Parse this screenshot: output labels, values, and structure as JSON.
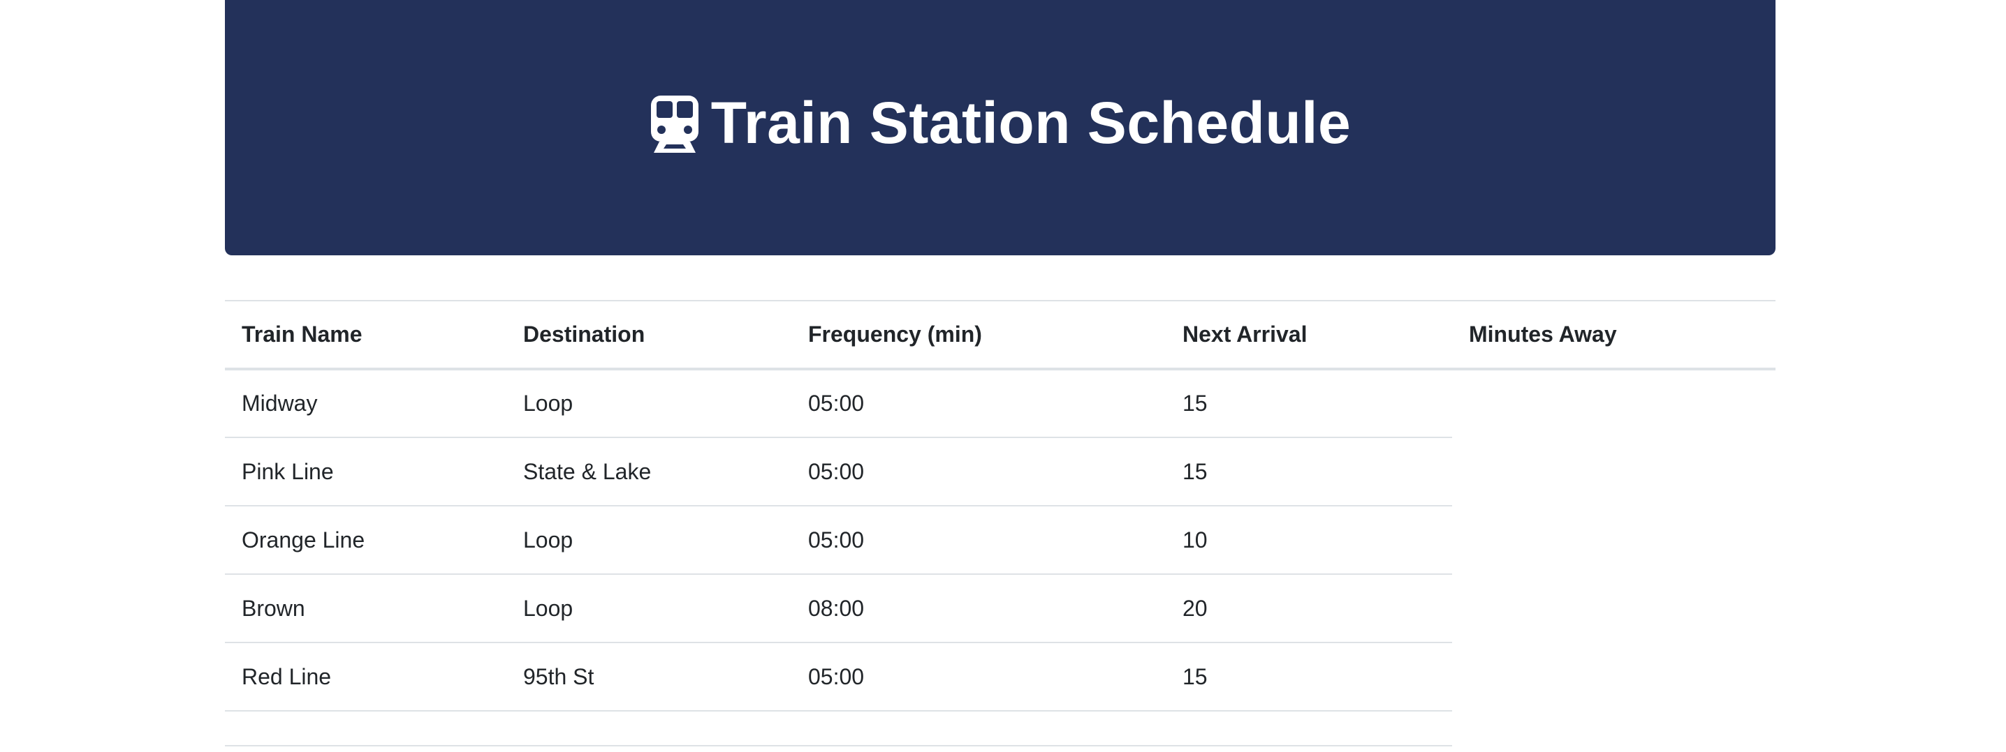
{
  "header": {
    "icon": "train-icon",
    "title": "Train Station Schedule",
    "background_color": "#23315a"
  },
  "table": {
    "columns": [
      "Train Name",
      "Destination",
      "Frequency (min)",
      "Next Arrival",
      "Minutes Away"
    ],
    "rows": [
      {
        "train_name": "Midway",
        "destination": "Loop",
        "frequency": "05:00",
        "next_arrival": "15",
        "minutes_away": ""
      },
      {
        "train_name": "Pink Line",
        "destination": "State & Lake",
        "frequency": "05:00",
        "next_arrival": "15",
        "minutes_away": ""
      },
      {
        "train_name": "Orange Line",
        "destination": "Loop",
        "frequency": "05:00",
        "next_arrival": "10",
        "minutes_away": ""
      },
      {
        "train_name": "Brown",
        "destination": "Loop",
        "frequency": "08:00",
        "next_arrival": "20",
        "minutes_away": ""
      },
      {
        "train_name": "Red Line",
        "destination": "95th St",
        "frequency": "05:00",
        "next_arrival": "15",
        "minutes_away": ""
      }
    ]
  }
}
